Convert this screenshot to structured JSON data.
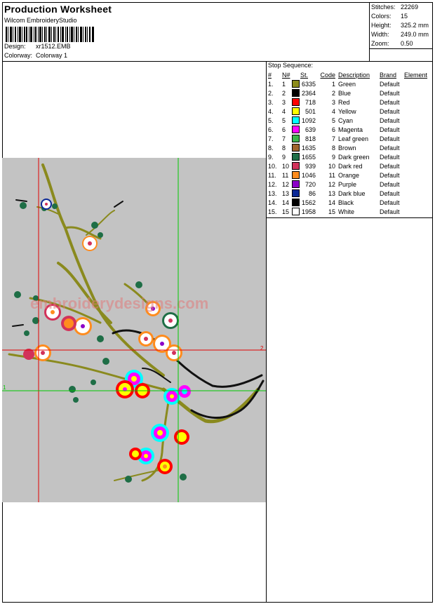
{
  "header": {
    "title": "Production Worksheet",
    "software": "Wilcom EmbroideryStudio",
    "design_label": "Design:",
    "design_value": "xr1512.EMB",
    "colorway_label": "Colorway:",
    "colorway_value": "Colorway 1"
  },
  "stats": {
    "stitches_label": "Stitches:",
    "stitches_value": "22269",
    "colors_label": "Colors:",
    "colors_value": "15",
    "height_label": "Height:",
    "height_value": "325.2 mm",
    "width_label": "Width:",
    "width_value": "249.0 mm",
    "zoom_label": "Zoom:",
    "zoom_value": "0.50"
  },
  "preview": {
    "watermark": "embroiderydesigns.com",
    "marker_top_right": "2",
    "marker_left": "1"
  },
  "sequence": {
    "title": "Stop Sequence:",
    "headers": {
      "num": "#",
      "n": "N#",
      "st": "St.",
      "code": "Code",
      "desc": "Description",
      "brand": "Brand",
      "element": "Element"
    },
    "rows": [
      {
        "num": "1.",
        "n": "1",
        "color": "#8c8c1c",
        "st": "6335",
        "code": "1",
        "desc": "Green",
        "brand": "Default"
      },
      {
        "num": "2.",
        "n": "2",
        "color": "#000000",
        "st": "2364",
        "code": "2",
        "desc": "Blue",
        "brand": "Default"
      },
      {
        "num": "3.",
        "n": "3",
        "color": "#ff0000",
        "st": "718",
        "code": "3",
        "desc": "Red",
        "brand": "Default"
      },
      {
        "num": "4.",
        "n": "4",
        "color": "#ffff00",
        "st": "501",
        "code": "4",
        "desc": "Yellow",
        "brand": "Default"
      },
      {
        "num": "5.",
        "n": "5",
        "color": "#00ffff",
        "st": "1092",
        "code": "5",
        "desc": "Cyan",
        "brand": "Default"
      },
      {
        "num": "6.",
        "n": "6",
        "color": "#ff00ff",
        "st": "639",
        "code": "6",
        "desc": "Magenta",
        "brand": "Default"
      },
      {
        "num": "7.",
        "n": "7",
        "color": "#3cb44b",
        "st": "818",
        "code": "7",
        "desc": "Leaf green",
        "brand": "Default"
      },
      {
        "num": "8.",
        "n": "8",
        "color": "#a0642d",
        "st": "1635",
        "code": "8",
        "desc": "Brown",
        "brand": "Default"
      },
      {
        "num": "9.",
        "n": "9",
        "color": "#1e6e46",
        "st": "1655",
        "code": "9",
        "desc": "Dark green",
        "brand": "Default"
      },
      {
        "num": "10.",
        "n": "10",
        "color": "#d2325a",
        "st": "939",
        "code": "10",
        "desc": "Dark red",
        "brand": "Default"
      },
      {
        "num": "11.",
        "n": "11",
        "color": "#ff8c1e",
        "st": "1046",
        "code": "11",
        "desc": "Orange",
        "brand": "Default"
      },
      {
        "num": "12.",
        "n": "12",
        "color": "#8c00c8",
        "st": "720",
        "code": "12",
        "desc": "Purple",
        "brand": "Default"
      },
      {
        "num": "13.",
        "n": "13",
        "color": "#0a2896",
        "st": "86",
        "code": "13",
        "desc": "Dark blue",
        "brand": "Default"
      },
      {
        "num": "14.",
        "n": "14",
        "color": "#000000",
        "st": "1562",
        "code": "14",
        "desc": "Black",
        "brand": "Default"
      },
      {
        "num": "15.",
        "n": "15",
        "color": "#ffffff",
        "st": "1958",
        "code": "15",
        "desc": "White",
        "brand": "Default"
      }
    ]
  }
}
